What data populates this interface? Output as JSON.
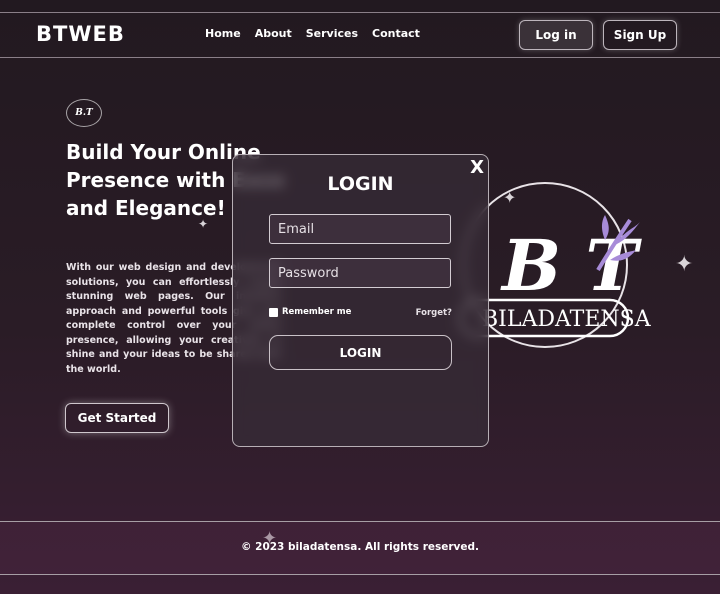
{
  "nav": {
    "brand": "BTWEB",
    "links": [
      "Home",
      "About",
      "Services",
      "Contact"
    ],
    "login_label": "Log in",
    "signup_label": "Sign Up"
  },
  "hero": {
    "logo_text": "B.T",
    "title": "Build Your Online Presence with Ease and Elegance!",
    "description": "With our web design and development solutions, you can effortlessly create stunning web pages. Our intuitive approach and powerful tools give you complete control over your online presence, allowing your creativity to shine and your ideas to be shared with the world.",
    "cta_label": "Get Started"
  },
  "emblem": {
    "monogram": "B T",
    "wordmark": "BILADATENSA"
  },
  "login_modal": {
    "close_label": "X",
    "title": "LOGIN",
    "email_placeholder": "Email",
    "password_placeholder": "Password",
    "remember_label": "Remember me",
    "forget_label": "Forget?",
    "submit_label": "LOGIN"
  },
  "footer": {
    "copyright": "© 2023 biladatensa. All rights reserved."
  },
  "colors": {
    "background": "#251a22",
    "accent_purple": "#a78bd8",
    "border": "#b7afb5"
  }
}
